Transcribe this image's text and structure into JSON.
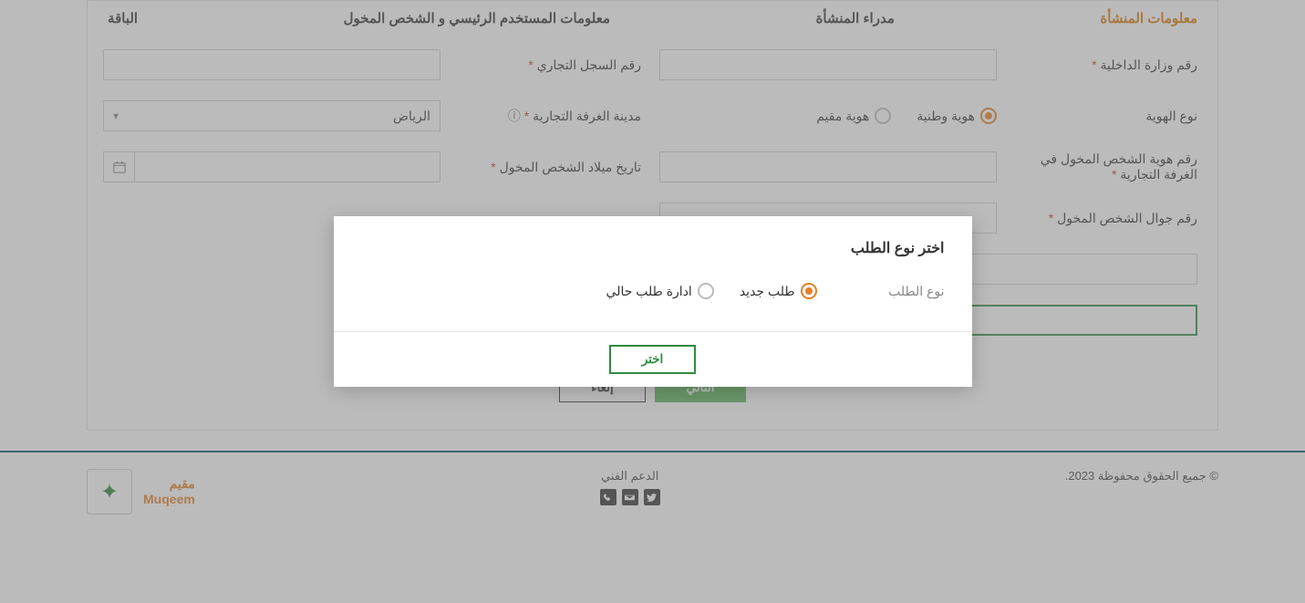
{
  "tabs": {
    "t1": "معلومات المنشأة",
    "t2": "مدراء المنشأة",
    "t3": "معلومات المستخدم الرئيسي و الشخص المخول",
    "t4": "الباقة"
  },
  "labels": {
    "moi_number": "رقم وزارة الداخلية",
    "cr_number": "رقم السجل التجاري",
    "id_type": "نوع الهوية",
    "chamber_city": "مدينة الغرفة التجارية",
    "auth_id": "رقم هوية الشخص المخول في الغرفة التجارية",
    "auth_dob": "تاريخ ميلاد الشخص المخول",
    "auth_mobile": "رقم جوال الشخص المخول",
    "req": "*"
  },
  "id_type_options": {
    "national": "هوية وطنية",
    "resident": "هوية مقيم"
  },
  "chamber_city_value": "الرياض",
  "actions": {
    "next": "التالي",
    "cancel": "إلغاء"
  },
  "footer": {
    "copyright": "© جميع الحقوق محفوظة 2023.",
    "support": "الدعم الفني",
    "brand_ar": "مقيم",
    "brand_en": "Muqeem"
  },
  "modal": {
    "title": "اختر نوع الطلب",
    "label": "نوع الطلب",
    "opt_new": "طلب جديد",
    "opt_manage": "ادارة طلب حالي",
    "choose": "اختر"
  }
}
